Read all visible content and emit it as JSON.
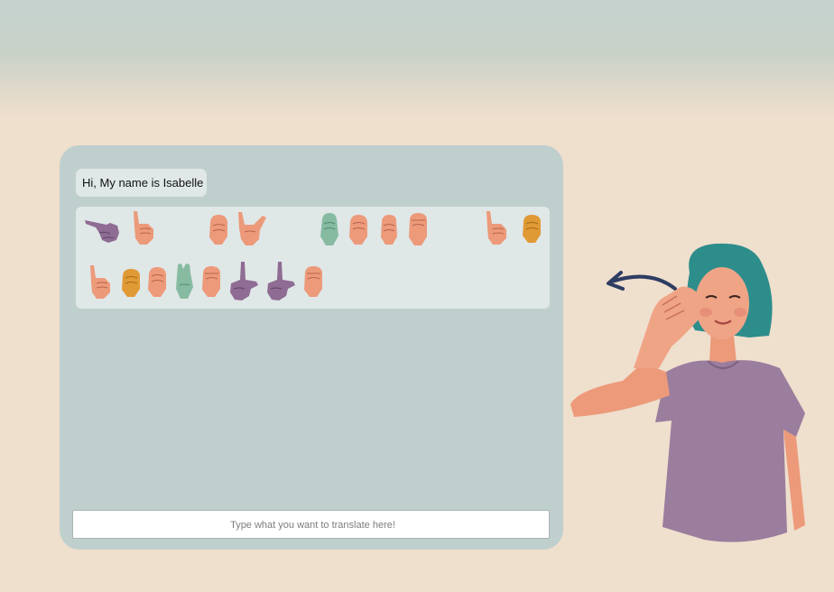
{
  "message": {
    "text": "Hi, My name is Isabelle"
  },
  "translator": {
    "placeholder": "Type what you want to translate here!"
  },
  "signs": {
    "row1": [
      "H",
      "I",
      "M",
      "Y",
      "N",
      "A",
      "M",
      "E",
      "I",
      "S"
    ],
    "row2": [
      "I",
      "S",
      "A",
      "B",
      "E",
      "L",
      "L",
      "E"
    ],
    "colors": {
      "skin": "#ec9a7a",
      "purple": "#8e6c93",
      "green": "#86bba2",
      "orange": "#e09a35"
    }
  },
  "colors": {
    "background": "#efdfcd",
    "panel": "#bfcfcd",
    "card": "#e0e7e7",
    "arrow": "#2e3d62",
    "shirt": "#9b7d9e",
    "hair": "#2d8d8b"
  }
}
